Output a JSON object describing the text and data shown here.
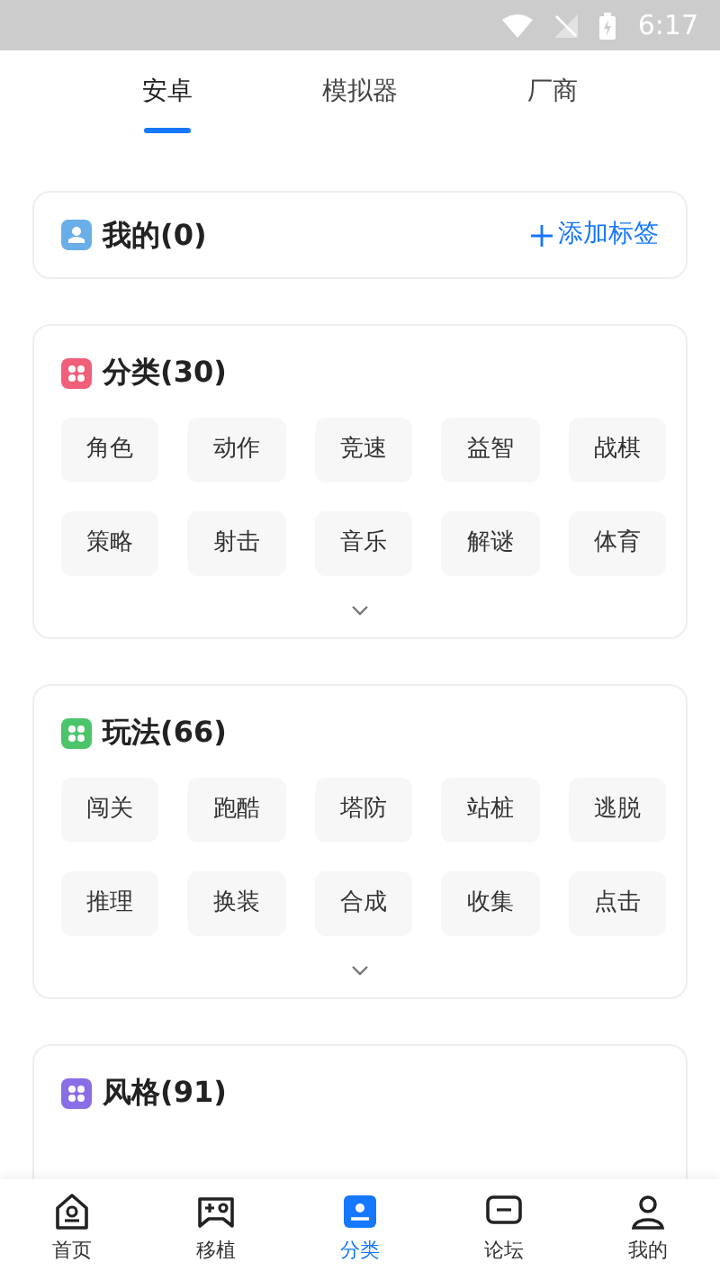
{
  "status_bar": {
    "time": "6:17"
  },
  "tabs": [
    {
      "label": "安卓",
      "selected": true
    },
    {
      "label": "模拟器",
      "selected": false
    },
    {
      "label": "厂商",
      "selected": false
    }
  ],
  "mine": {
    "title": "我的(0)",
    "action": "添加标签"
  },
  "sections": [
    {
      "title": "分类(30)",
      "color": "#f0607a",
      "tags": [
        "角色",
        "动作",
        "竞速",
        "益智",
        "战棋",
        "策略",
        "射击",
        "音乐",
        "解谜",
        "体育"
      ]
    },
    {
      "title": "玩法(66)",
      "color": "#4cc46a",
      "tags": [
        "闯关",
        "跑酷",
        "塔防",
        "站桩",
        "逃脱",
        "推理",
        "换装",
        "合成",
        "收集",
        "点击"
      ]
    },
    {
      "title": "风格(91)",
      "color": "#8a6ee6"
    }
  ],
  "nav": [
    {
      "label": "首页",
      "kind": "home",
      "selected": false
    },
    {
      "label": "移植",
      "kind": "gamepad",
      "selected": false
    },
    {
      "label": "分类",
      "kind": "category",
      "selected": true
    },
    {
      "label": "论坛",
      "kind": "forum",
      "selected": false
    },
    {
      "label": "我的",
      "kind": "me",
      "selected": false
    }
  ]
}
